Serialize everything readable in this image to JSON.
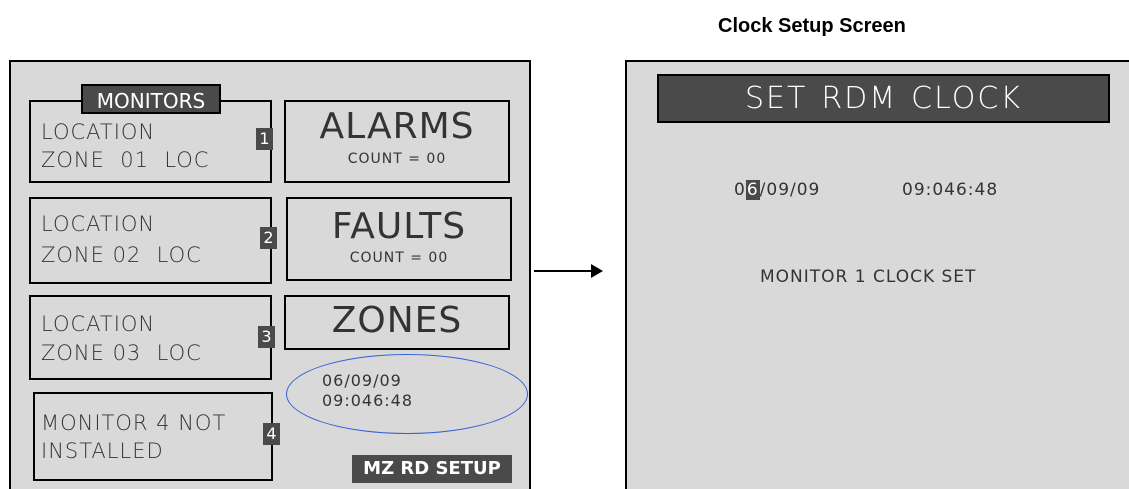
{
  "left": {
    "monitors_tab": "MONITORS",
    "monitor_rows": [
      {
        "line1": "LOCATION",
        "line2": "ZONE  01  LOC",
        "number": "1"
      },
      {
        "line1": "LOCATION",
        "line2": "ZONE 02  LOC",
        "number": "2"
      },
      {
        "line1": "LOCATION",
        "line2": "ZONE 03  LOC",
        "number": "3"
      },
      {
        "line1": "MONITOR 4 NOT",
        "line2": "INSTALLED",
        "number": "4"
      }
    ],
    "alarms": {
      "label": "ALARMS",
      "count": "COUNT = 00"
    },
    "faults": {
      "label": "FAULTS",
      "count": "COUNT = 00"
    },
    "zones": {
      "label": "ZONES"
    },
    "date": "06/09/09",
    "time": "09:046:48",
    "setup_button": "MZ RD SETUP"
  },
  "right": {
    "title": "Clock Setup Screen",
    "header_words": [
      "SET",
      "RDM",
      "CLOCK"
    ],
    "date_prefix": "0",
    "date_cursor": "6",
    "date_suffix": "/09/09",
    "time": "09:046:48",
    "status": "MONITOR 1 CLOCK SET"
  },
  "colors": {
    "panel": "#d9d9d9",
    "dark": "#4a4a4a",
    "ellipse": "#2f5fd8"
  }
}
